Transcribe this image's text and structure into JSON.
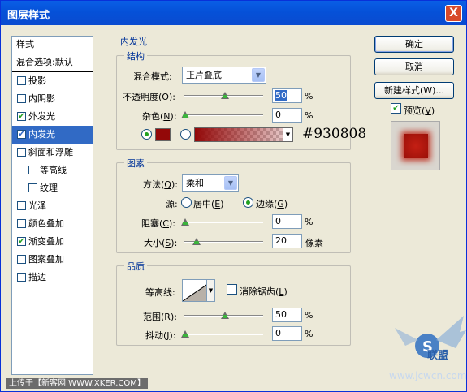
{
  "window": {
    "title": "图层样式",
    "close": "X"
  },
  "stylelist": {
    "header": "样式",
    "blend": "混合选项:默认",
    "items": [
      {
        "label": "投影",
        "checked": false
      },
      {
        "label": "内阴影",
        "checked": false
      },
      {
        "label": "外发光",
        "checked": true
      },
      {
        "label": "内发光",
        "checked": true,
        "selected": true
      },
      {
        "label": "斜面和浮雕",
        "checked": false
      },
      {
        "label": "等高线",
        "checked": false,
        "sub": true
      },
      {
        "label": "纹理",
        "checked": false,
        "sub": true
      },
      {
        "label": "光泽",
        "checked": false
      },
      {
        "label": "颜色叠加",
        "checked": false
      },
      {
        "label": "渐变叠加",
        "checked": true
      },
      {
        "label": "图案叠加",
        "checked": false
      },
      {
        "label": "描边",
        "checked": false
      }
    ]
  },
  "panel": {
    "title": "内发光",
    "structure": {
      "title": "结构",
      "blend_label_pre": "混合模式:",
      "blend_value": "正片叠底",
      "opacity_label": "不透明度(",
      "opacity_key": "O",
      "opacity_value": "50",
      "noise_label": "杂色(",
      "noise_key": "N",
      "noise_value": "0",
      "pct": "%",
      "hex": "#930808",
      "color": "#930808"
    },
    "elements": {
      "title": "图素",
      "method_label": "方法(",
      "method_key": "Q",
      "method_value": "柔和",
      "source_label": "源:",
      "center_label": "居中(",
      "center_key": "E",
      "edge_label": "边缘(",
      "edge_key": "G",
      "choke_label": "阻塞(",
      "choke_key": "C",
      "choke_value": "0",
      "size_label": "大小(",
      "size_key": "S",
      "size_value": "20",
      "size_unit": "像素"
    },
    "quality": {
      "title": "品质",
      "contour_label": "等高线:",
      "antialias_label": "消除锯齿(",
      "antialias_key": "L",
      "range_label": "范围(",
      "range_key": "R",
      "range_value": "50",
      "jitter_label": "抖动(",
      "jitter_key": "J",
      "jitter_value": "0"
    }
  },
  "buttons": {
    "ok": "确定",
    "cancel": "取消",
    "new_style": "新建样式(W)...",
    "preview": "预览(",
    "preview_key": "V"
  },
  "footer": "上传于【新客网 WWW.XKER.COM】",
  "watermark": {
    "brand": "联盟",
    "url": "www.jcwcn.com"
  }
}
